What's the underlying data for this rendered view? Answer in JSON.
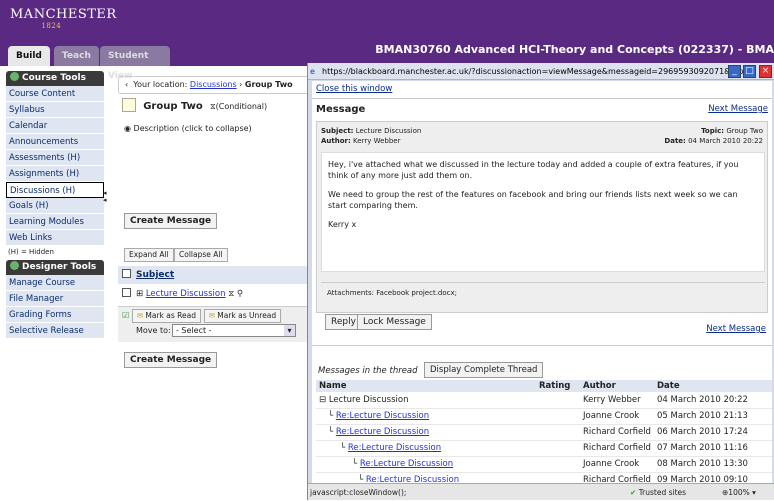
{
  "header": {
    "logo_top": "MANCHESTER",
    "logo_year": "1824",
    "course_title": "BMAN30760 Advanced HCI-Theory and Concepts (022337) - BMA",
    "tabs": [
      "Build",
      "Teach",
      "Student View"
    ]
  },
  "sidebar": {
    "course_tools_title": "Course Tools",
    "items": [
      {
        "label": "Course Content"
      },
      {
        "label": "Syllabus"
      },
      {
        "label": "Calendar"
      },
      {
        "label": "Announcements"
      },
      {
        "label": "Assessments (H)"
      },
      {
        "label": "Assignments (H)"
      },
      {
        "label": "Discussions (H)"
      },
      {
        "label": "Goals (H)"
      },
      {
        "label": "Learning Modules"
      },
      {
        "label": "Web Links"
      }
    ],
    "hidden_note": "(H) = Hidden",
    "designer_tools_title": "Designer Tools",
    "designer_items": [
      {
        "label": "Manage Course"
      },
      {
        "label": "File Manager"
      },
      {
        "label": "Grading Forms"
      },
      {
        "label": "Selective Release"
      }
    ]
  },
  "main": {
    "location_label": "Your location:",
    "location_link": "Discussions",
    "location_sep": "›",
    "location_current": "Group Two",
    "group_title": "Group Two",
    "group_condition": "(Conditional)",
    "description": "Description (click to collapse)",
    "create_message": "Create Message",
    "expand_all": "Expand All",
    "collapse_all": "Collapse All",
    "subject_header": "Subject",
    "topic_link": "Lecture Discussion",
    "mark_read": "Mark as Read",
    "mark_unread": "Mark as Unread",
    "move_to": "Move to:",
    "select_default": "- Select -"
  },
  "popup": {
    "url": "https://blackboard.manchester.ac.uk/?discussionaction=viewMessage&messageid=2969593092071&topic - ...",
    "close_link": "Close this window",
    "message_label": "Message",
    "next_message": "Next Message",
    "subject_label": "Subject:",
    "subject_value": "Lecture Discussion",
    "topic_label": "Topic:",
    "topic_value": "Group Two",
    "author_label": "Author:",
    "author_value": "Kerry Webber",
    "date_label": "Date:",
    "date_value": "04 March 2010 20:22",
    "body_p1": "Hey, i've attached what we discussed in the lecture today and added a couple of extra features, if you think of any more just add them on.",
    "body_p2": "We need to group the rest of the features on facebook and bring our friends lists next week so we can start comparing them.",
    "body_p3": "Kerry x",
    "attachments_label": "Attachments:",
    "attachment_file": "Facebook project.docx",
    "attachment_suffix": ";",
    "reply": "Reply",
    "lock_message": "Lock Message",
    "next_message_2": "Next Message",
    "thread_label": "Messages in the thread",
    "display_thread": "Display Complete Thread",
    "columns": [
      "Name",
      "Rating",
      "Author",
      "Date"
    ],
    "rows": [
      {
        "name": "Lecture Discussion",
        "author": "Kerry Webber",
        "date": "04 March 2010 20:22"
      },
      {
        "name": "Re:Lecture Discussion",
        "author": "Joanne Crook",
        "date": "05 March 2010 21:13"
      },
      {
        "name": "Re:Lecture Discussion",
        "author": "Richard Corfield",
        "date": "06 March 2010 17:24"
      },
      {
        "name": "Re:Lecture Discussion",
        "author": "Richard Corfield",
        "date": "07 March 2010 11:16"
      },
      {
        "name": "Re:Lecture Discussion",
        "author": "Joanne Crook",
        "date": "08 March 2010 13:30"
      },
      {
        "name": "Re:Lecture Discussion",
        "author": "Richard Corfield",
        "date": "09 March 2010 09:10"
      }
    ],
    "status_left": "javascript:closeWindow();",
    "status_zone": "Trusted sites",
    "status_zoom": "100%"
  },
  "colors": {
    "header_purple": "#5a2a82",
    "nav_bg": "#dfe6f1",
    "link_blue": "#2233cc"
  }
}
